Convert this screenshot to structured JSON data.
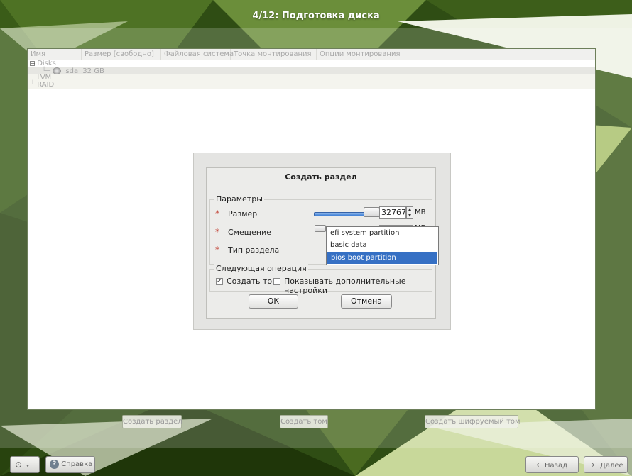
{
  "window": {
    "title": "4/12: Подготовка диска"
  },
  "table": {
    "columns": [
      "Имя",
      "Размер [свободно]",
      "Файловая система",
      "Точка монтирования",
      "Опции монтирования"
    ],
    "tree": {
      "disks_label": "Disks",
      "disk_name": "sda",
      "disk_size": "32 GB",
      "lvm_label": "LVM",
      "raid_label": "RAID"
    }
  },
  "dialog": {
    "title": "Создать раздел",
    "params_group": "Параметры",
    "size_label": "Размер",
    "size_value": "32767",
    "size_unit": "MB",
    "size_slider_fraction": 1.0,
    "offset_label": "Смещение",
    "offset_unit": "MB",
    "type_label": "Тип раздела",
    "required_mark": "*",
    "partition_type_options": [
      "efi system partition",
      "basic data",
      "bios boot partition"
    ],
    "partition_type_selected": "bios boot partition",
    "next_group": "Следующая операция",
    "create_volume_label": "Создать том",
    "create_volume_checked": true,
    "show_advanced_label": "Показывать дополнительные настройки",
    "show_advanced_checked": false,
    "ok_label": "ОК",
    "cancel_label": "Отмена"
  },
  "actions": {
    "create_partition": "Создать раздел",
    "create_volume": "Создать том",
    "create_encrypted_volume": "Создать шифруемый том"
  },
  "footer": {
    "help_label": "Справка",
    "back_label": "Назад",
    "next_label": "Далее"
  },
  "colors": {
    "selection_blue": "#3670c4",
    "required_red": "#c0392b",
    "background_green": "#2d4a12"
  }
}
